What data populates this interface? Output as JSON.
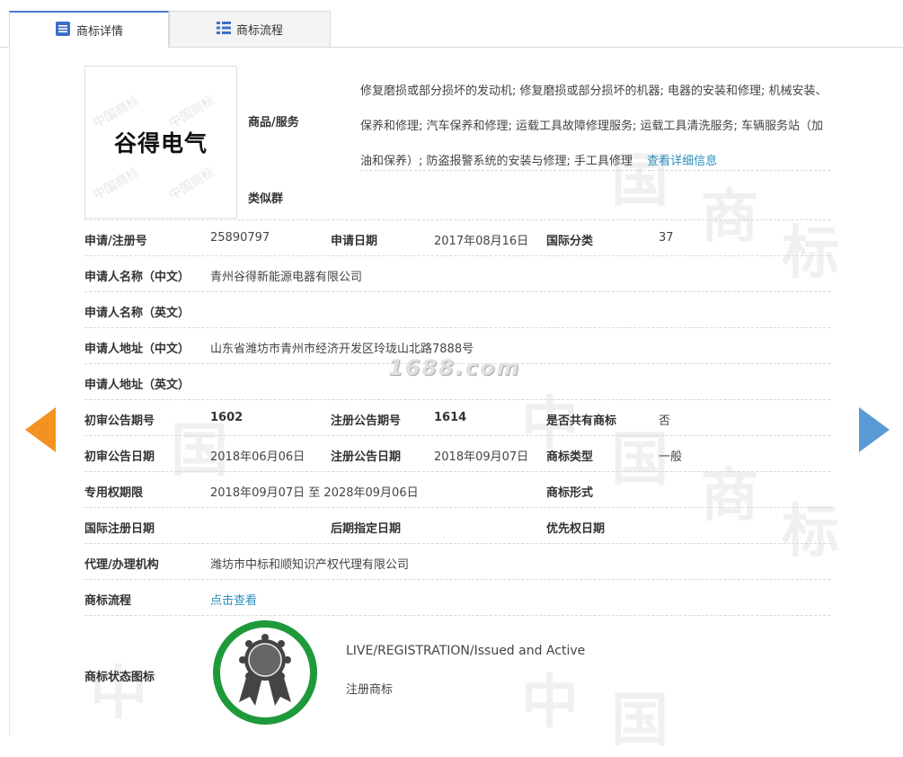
{
  "tabs": [
    {
      "label": "商标详情",
      "icon": "document-list-icon"
    },
    {
      "label": "商标流程",
      "icon": "list-icon"
    }
  ],
  "logo": {
    "text": "谷得电气",
    "watermark": "中国商标"
  },
  "goods": {
    "label": "商品/服务",
    "text": "修复磨损或部分损坏的发动机; 修复磨损或部分损坏的机器; 电器的安装和修理; 机械安装、保养和修理; 汽车保养和修理; 运载工具故障修理服务; 运载工具清洗服务; 车辆服务站（加油和保养）; 防盗报警系统的安装与修理; 手工具修理",
    "more_link": "查看详细信息"
  },
  "similar_group": {
    "label": "类似群"
  },
  "fields": {
    "reg_no_label": "申请/注册号",
    "reg_no": "25890797",
    "app_date_label": "申请日期",
    "app_date": "2017年08月16日",
    "intl_class_label": "国际分类",
    "intl_class": "37",
    "applicant_cn_label": "申请人名称（中文）",
    "applicant_cn": "青州谷得新能源电器有限公司",
    "applicant_en_label": "申请人名称（英文）",
    "address_cn_label": "申请人地址（中文）",
    "address_cn": "山东省潍坊市青州市经济开发区玲珑山北路7888号",
    "address_en_label": "申请人地址（英文）",
    "prelim_no_label": "初审公告期号",
    "prelim_no": "1602",
    "reg_pub_no_label": "注册公告期号",
    "reg_pub_no": "1614",
    "shared_label": "是否共有商标",
    "shared": "否",
    "prelim_date_label": "初审公告日期",
    "prelim_date": "2018年06月06日",
    "reg_pub_date_label": "注册公告日期",
    "reg_pub_date": "2018年09月07日",
    "tm_type_label": "商标类型",
    "tm_type": "一般",
    "exclusive_label": "专用权期限",
    "exclusive": "2018年09月07日 至 2028年09月06日",
    "tm_form_label": "商标形式",
    "intl_reg_date_label": "国际注册日期",
    "later_date_label": "后期指定日期",
    "priority_date_label": "优先权日期",
    "agent_label": "代理/办理机构",
    "agent": "潍坊市中标和顺知识产权代理有限公司",
    "flow_label": "商标流程",
    "flow_link": "点击查看",
    "status_icon_label": "商标状态图标"
  },
  "status": {
    "en": "LIVE/REGISTRATION/Issued and Active",
    "cn": "注册商标"
  },
  "watermark_site": "1688.com",
  "colors": {
    "tab_accent": "#4a7bd0",
    "link": "#2a8fbd",
    "arrow_left": "#f39221",
    "arrow_right": "#5b9bd5",
    "badge_ring": "#1e9a3a"
  }
}
